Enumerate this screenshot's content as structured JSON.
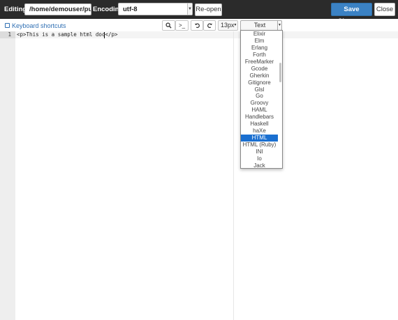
{
  "topbar": {
    "editing_label": "Editing:",
    "file_path": "/home/demouser/public_html",
    "encoding_label": "Encoding:",
    "encoding_value": "utf-8",
    "reopen_label": "Re-open",
    "save_label": "Save Changes",
    "close_label": "Close"
  },
  "toolbar": {
    "keyboard_shortcuts": "Keyboard shortcuts",
    "search_icon": "search-icon",
    "terminal_label": ">_",
    "undo_icon": "undo-icon",
    "redo_icon": "redo-icon",
    "font_size": "13px",
    "mode": "Text"
  },
  "editor": {
    "line_numbers": [
      "1"
    ],
    "lines": [
      "<p>This is a sample html doc</p>"
    ]
  },
  "mode_dropdown": {
    "items": [
      "Elixir",
      "Elm",
      "Erlang",
      "Forth",
      "FreeMarker",
      "Gcode",
      "Gherkin",
      "Gitignore",
      "Glsl",
      "Go",
      "Groovy",
      "HAML",
      "Handlebars",
      "Haskell",
      "haXe",
      "HTML",
      "HTML (Ruby)",
      "INI",
      "Io",
      "Jack"
    ],
    "selected": "HTML"
  },
  "colors": {
    "topbar_bg": "#2b2b2b",
    "primary_button": "#3b82c4",
    "link": "#2f6fb3",
    "selected_item": "#1a6fd0"
  }
}
